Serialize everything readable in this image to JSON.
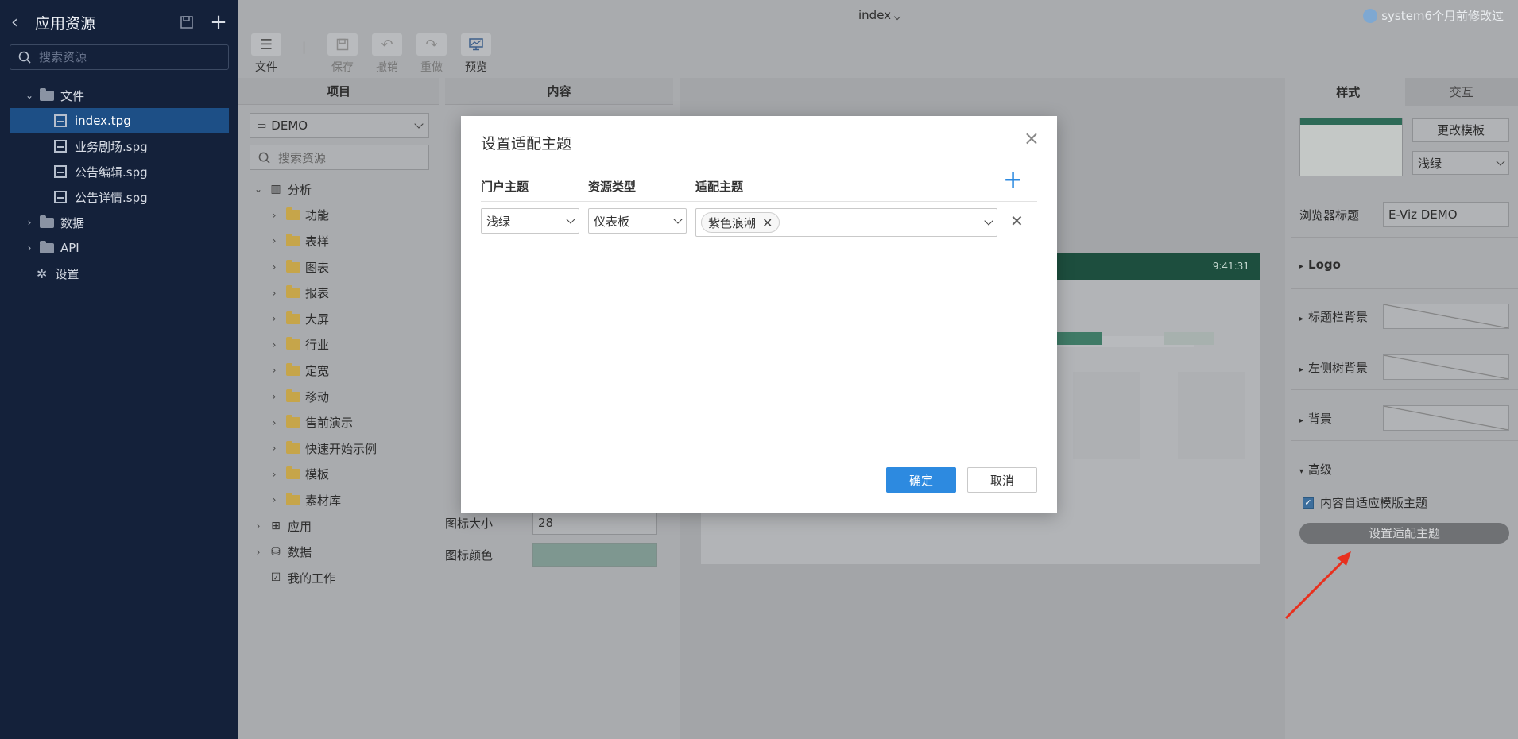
{
  "sidebar": {
    "title": "应用资源",
    "search_placeholder": "搜索资源",
    "tree": [
      {
        "label": "文件",
        "caret": "⌄"
      },
      {
        "label": "index.tpg"
      },
      {
        "label": "业务剧场.spg"
      },
      {
        "label": "公告编辑.spg"
      },
      {
        "label": "公告详情.spg"
      },
      {
        "label": "数据",
        "caret": "›"
      },
      {
        "label": "API",
        "caret": "›"
      },
      {
        "label": "设置"
      }
    ]
  },
  "topbar": {
    "doc_title": "index",
    "status": "system6个月前修改过"
  },
  "toolbar": {
    "file": "文件",
    "save": "保存",
    "undo": "撤销",
    "redo": "重做",
    "preview": "预览"
  },
  "columns": {
    "project": "项目",
    "content": "内容"
  },
  "project": {
    "select_value": "DEMO",
    "search_placeholder": "搜索资源",
    "tree": [
      {
        "label": "分析"
      },
      {
        "label": "功能"
      },
      {
        "label": "表样"
      },
      {
        "label": "图表"
      },
      {
        "label": "报表"
      },
      {
        "label": "大屏"
      },
      {
        "label": "行业"
      },
      {
        "label": "定宽"
      },
      {
        "label": "移动"
      },
      {
        "label": "售前演示"
      },
      {
        "label": "快速开始示例"
      },
      {
        "label": "模板"
      },
      {
        "label": "素材库"
      },
      {
        "label": "应用"
      },
      {
        "label": "数据"
      },
      {
        "label": "我的工作"
      }
    ]
  },
  "props": {
    "icon_size_label": "图标大小",
    "icon_size_value": "28",
    "icon_color_label": "图标颜色",
    "icon_color": "#7e9790"
  },
  "preview": {
    "time": "9:41:31"
  },
  "right": {
    "tab_style": "样式",
    "tab_interaction": "交互",
    "change_template": "更改模板",
    "theme_value": "浅绿",
    "browser_title_label": "浏览器标题",
    "browser_title_value": "E-Viz DEMO",
    "logo": "Logo",
    "title_bg": "标题栏背景",
    "left_tree_bg": "左侧树背景",
    "bg": "背景",
    "advanced": "高级",
    "adapt_checkbox": "内容自适应模版主题",
    "adapt_button": "设置适配主题"
  },
  "modal": {
    "title": "设置适配主题",
    "col_portal_theme": "门户主题",
    "col_resource_type": "资源类型",
    "col_adapt_theme": "适配主题",
    "row": {
      "portal_theme": "浅绿",
      "resource_type": "仪表板",
      "adapt_tag": "紫色浪潮"
    },
    "ok": "确定",
    "cancel": "取消"
  },
  "colors": {
    "primary": "#2d8ae0",
    "sidebar_bg": "#14213a",
    "selected_bg": "#1d4f86",
    "arrow": "#e8301e"
  }
}
